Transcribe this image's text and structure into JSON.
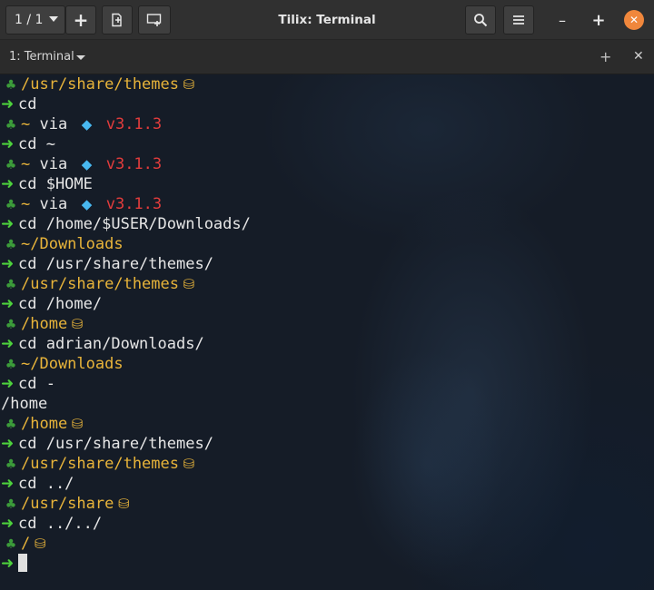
{
  "window": {
    "title": "Tilix: Terminal",
    "session_label": "1 / 1",
    "add_terminal_label": "+",
    "minimize_label": "–",
    "maximize_label": "+",
    "close_label": "✕"
  },
  "tab": {
    "label": "1: Terminal",
    "add_label": "+",
    "close_label": "✕"
  },
  "colors": {
    "prompt_arrow": "#4dd13c",
    "path": "#e8b43a",
    "version": "#e23c3c",
    "text": "#e6e6e6",
    "close_button": "#f0873c"
  },
  "terminal": {
    "lines": [
      {
        "type": "prompt",
        "path": "/usr/share/themes",
        "locked": true
      },
      {
        "type": "cmd",
        "text": "cd"
      },
      {
        "type": "prompt",
        "path": "~",
        "via": "via",
        "version": "v3.1.3"
      },
      {
        "type": "cmd",
        "text": "cd ~"
      },
      {
        "type": "prompt",
        "path": "~",
        "via": "via",
        "version": "v3.1.3"
      },
      {
        "type": "cmd",
        "text": "cd $HOME"
      },
      {
        "type": "prompt",
        "path": "~",
        "via": "via",
        "version": "v3.1.3"
      },
      {
        "type": "cmd",
        "text": "cd /home/$USER/Downloads/"
      },
      {
        "type": "prompt",
        "path": "~/Downloads"
      },
      {
        "type": "cmd",
        "text": "cd /usr/share/themes/"
      },
      {
        "type": "prompt",
        "path": "/usr/share/themes",
        "locked": true
      },
      {
        "type": "cmd",
        "text": "cd /home/"
      },
      {
        "type": "prompt",
        "path": "/home",
        "locked": true
      },
      {
        "type": "cmd",
        "text": "cd adrian/Downloads/"
      },
      {
        "type": "prompt",
        "path": "~/Downloads"
      },
      {
        "type": "cmd",
        "text": "cd -"
      },
      {
        "type": "output",
        "text": "/home"
      },
      {
        "type": "prompt",
        "path": "/home",
        "locked": true
      },
      {
        "type": "cmd",
        "text": "cd /usr/share/themes/"
      },
      {
        "type": "prompt",
        "path": "/usr/share/themes",
        "locked": true
      },
      {
        "type": "cmd",
        "text": "cd ../"
      },
      {
        "type": "prompt",
        "path": "/usr/share",
        "locked": true
      },
      {
        "type": "cmd",
        "text": "cd ../../"
      },
      {
        "type": "prompt",
        "path": "/",
        "locked": true
      },
      {
        "type": "input",
        "text": ""
      }
    ]
  }
}
